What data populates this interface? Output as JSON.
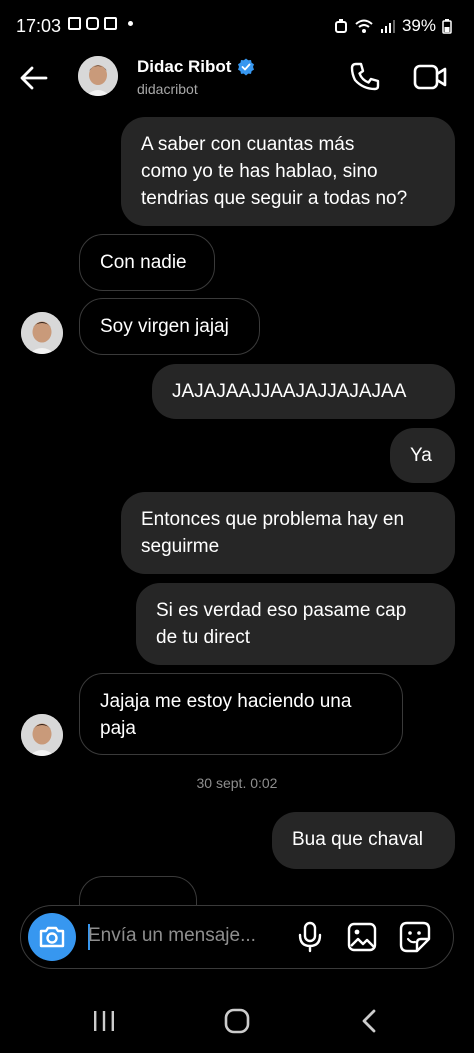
{
  "status_bar": {
    "time": "17:03",
    "battery": "39%"
  },
  "header": {
    "name": "Didac Ribot",
    "username": "didacribot"
  },
  "messages": [
    {
      "side": "out",
      "text": "A saber con cuantas más\ncomo yo te has hablao, sino\ntendrias que seguir a todas no?"
    },
    {
      "side": "in",
      "text": "Con nadie"
    },
    {
      "side": "in",
      "text": "Soy virgen jajaj"
    },
    {
      "side": "out",
      "text": "JAJAJAAJJAAJAJJAJAJAA"
    },
    {
      "side": "out",
      "text": "Ya"
    },
    {
      "side": "out",
      "text": "Entonces que problema hay en\nseguirme"
    },
    {
      "side": "out",
      "text": "Si es verdad eso pasame cap\nde tu direct"
    },
    {
      "side": "in",
      "text": "Jajaja me estoy haciendo una\npaja"
    },
    {
      "side": "out",
      "text": "Bua que chaval"
    }
  ],
  "date_separator": "30 sept. 0:02",
  "composer": {
    "placeholder": "Envía un mensaje..."
  },
  "colors": {
    "accent": "#3797f0",
    "bubble_out": "#262626",
    "background": "#000000"
  }
}
